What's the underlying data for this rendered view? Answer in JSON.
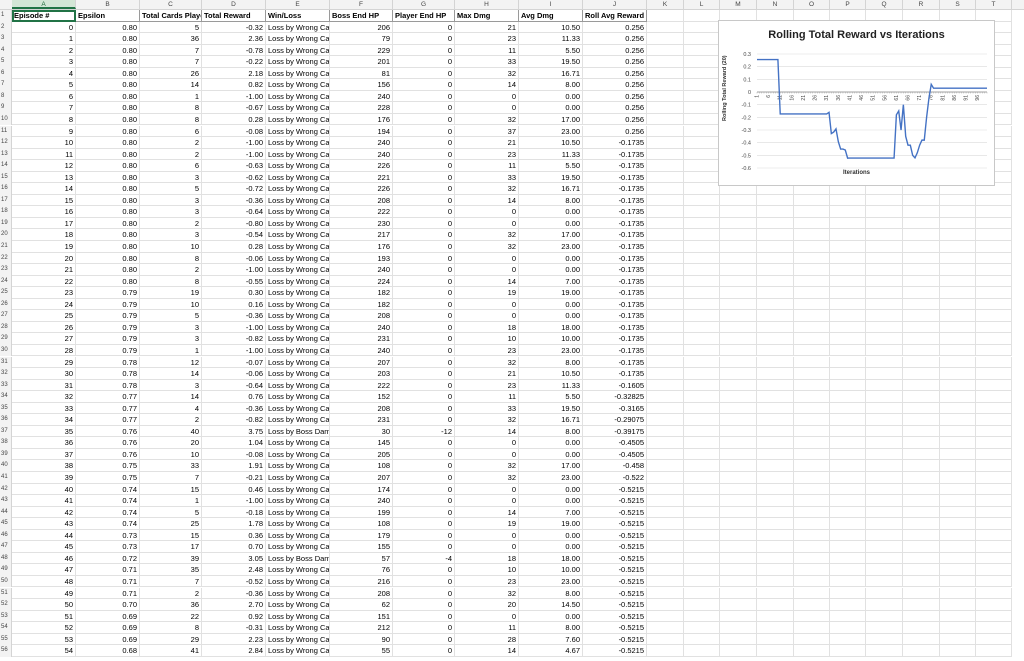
{
  "columns": [
    "A",
    "B",
    "C",
    "D",
    "E",
    "F",
    "G",
    "H",
    "I",
    "J",
    "K",
    "L",
    "M",
    "N",
    "O",
    "P",
    "Q",
    "R",
    "S",
    "T"
  ],
  "headers": [
    "Episode #",
    "Epsilon",
    "Total Cards Played",
    "Total Reward",
    "Win/Loss",
    "Boss End HP",
    "Player End HP",
    "Max Dmg",
    "Avg Dmg",
    "Roll Avg Reward"
  ],
  "rows": [
    [
      "0",
      "0.80",
      "5",
      "-0.32",
      "Loss by Wrong Card",
      "206",
      "0",
      "21",
      "10.50",
      "0.256"
    ],
    [
      "1",
      "0.80",
      "36",
      "2.36",
      "Loss by Wrong Card",
      "79",
      "0",
      "23",
      "11.33",
      "0.256"
    ],
    [
      "2",
      "0.80",
      "7",
      "-0.78",
      "Loss by Wrong Card",
      "229",
      "0",
      "11",
      "5.50",
      "0.256"
    ],
    [
      "3",
      "0.80",
      "7",
      "-0.22",
      "Loss by Wrong Card",
      "201",
      "0",
      "33",
      "19.50",
      "0.256"
    ],
    [
      "4",
      "0.80",
      "26",
      "2.18",
      "Loss by Wrong Card",
      "81",
      "0",
      "32",
      "16.71",
      "0.256"
    ],
    [
      "5",
      "0.80",
      "14",
      "0.82",
      "Loss by Wrong Card",
      "156",
      "0",
      "14",
      "8.00",
      "0.256"
    ],
    [
      "6",
      "0.80",
      "1",
      "-1.00",
      "Loss by Wrong Card",
      "240",
      "0",
      "0",
      "0.00",
      "0.256"
    ],
    [
      "7",
      "0.80",
      "8",
      "-0.67",
      "Loss by Wrong Card",
      "228",
      "0",
      "0",
      "0.00",
      "0.256"
    ],
    [
      "8",
      "0.80",
      "8",
      "0.28",
      "Loss by Wrong Card",
      "176",
      "0",
      "32",
      "17.00",
      "0.256"
    ],
    [
      "9",
      "0.80",
      "6",
      "-0.08",
      "Loss by Wrong Card",
      "194",
      "0",
      "37",
      "23.00",
      "0.256"
    ],
    [
      "10",
      "0.80",
      "2",
      "-1.00",
      "Loss by Wrong Card",
      "240",
      "0",
      "21",
      "10.50",
      "-0.1735"
    ],
    [
      "11",
      "0.80",
      "2",
      "-1.00",
      "Loss by Wrong Card",
      "240",
      "0",
      "23",
      "11.33",
      "-0.1735"
    ],
    [
      "12",
      "0.80",
      "6",
      "-0.63",
      "Loss by Wrong Card",
      "226",
      "0",
      "11",
      "5.50",
      "-0.1735"
    ],
    [
      "13",
      "0.80",
      "3",
      "-0.62",
      "Loss by Wrong Card",
      "221",
      "0",
      "33",
      "19.50",
      "-0.1735"
    ],
    [
      "14",
      "0.80",
      "5",
      "-0.72",
      "Loss by Wrong Card",
      "226",
      "0",
      "32",
      "16.71",
      "-0.1735"
    ],
    [
      "15",
      "0.80",
      "3",
      "-0.36",
      "Loss by Wrong Card",
      "208",
      "0",
      "14",
      "8.00",
      "-0.1735"
    ],
    [
      "16",
      "0.80",
      "3",
      "-0.64",
      "Loss by Wrong Card",
      "222",
      "0",
      "0",
      "0.00",
      "-0.1735"
    ],
    [
      "17",
      "0.80",
      "2",
      "-0.80",
      "Loss by Wrong Card",
      "230",
      "0",
      "0",
      "0.00",
      "-0.1735"
    ],
    [
      "18",
      "0.80",
      "3",
      "-0.54",
      "Loss by Wrong Card",
      "217",
      "0",
      "32",
      "17.00",
      "-0.1735"
    ],
    [
      "19",
      "0.80",
      "10",
      "0.28",
      "Loss by Wrong Card",
      "176",
      "0",
      "32",
      "23.00",
      "-0.1735"
    ],
    [
      "20",
      "0.80",
      "8",
      "-0.06",
      "Loss by Wrong Card",
      "193",
      "0",
      "0",
      "0.00",
      "-0.1735"
    ],
    [
      "21",
      "0.80",
      "2",
      "-1.00",
      "Loss by Wrong Card",
      "240",
      "0",
      "0",
      "0.00",
      "-0.1735"
    ],
    [
      "22",
      "0.80",
      "8",
      "-0.55",
      "Loss by Wrong Card",
      "224",
      "0",
      "14",
      "7.00",
      "-0.1735"
    ],
    [
      "23",
      "0.79",
      "19",
      "0.30",
      "Loss by Wrong Card",
      "182",
      "0",
      "19",
      "19.00",
      "-0.1735"
    ],
    [
      "24",
      "0.79",
      "10",
      "0.16",
      "Loss by Wrong Card",
      "182",
      "0",
      "0",
      "0.00",
      "-0.1735"
    ],
    [
      "25",
      "0.79",
      "5",
      "-0.36",
      "Loss by Wrong Card",
      "208",
      "0",
      "0",
      "0.00",
      "-0.1735"
    ],
    [
      "26",
      "0.79",
      "3",
      "-1.00",
      "Loss by Wrong Card",
      "240",
      "0",
      "18",
      "18.00",
      "-0.1735"
    ],
    [
      "27",
      "0.79",
      "3",
      "-0.82",
      "Loss by Wrong Card",
      "231",
      "0",
      "10",
      "10.00",
      "-0.1735"
    ],
    [
      "28",
      "0.79",
      "1",
      "-1.00",
      "Loss by Wrong Card",
      "240",
      "0",
      "23",
      "23.00",
      "-0.1735"
    ],
    [
      "29",
      "0.78",
      "12",
      "-0.07",
      "Loss by Wrong Card",
      "207",
      "0",
      "32",
      "8.00",
      "-0.1735"
    ],
    [
      "30",
      "0.78",
      "14",
      "-0.06",
      "Loss by Wrong Card",
      "203",
      "0",
      "21",
      "10.50",
      "-0.1735"
    ],
    [
      "31",
      "0.78",
      "3",
      "-0.64",
      "Loss by Wrong Card",
      "222",
      "0",
      "23",
      "11.33",
      "-0.1605"
    ],
    [
      "32",
      "0.77",
      "14",
      "0.76",
      "Loss by Wrong Card",
      "152",
      "0",
      "11",
      "5.50",
      "-0.32825"
    ],
    [
      "33",
      "0.77",
      "4",
      "-0.36",
      "Loss by Wrong Card",
      "208",
      "0",
      "33",
      "19.50",
      "-0.3165"
    ],
    [
      "34",
      "0.77",
      "2",
      "-0.82",
      "Loss by Wrong Card",
      "231",
      "0",
      "32",
      "16.71",
      "-0.29075"
    ],
    [
      "35",
      "0.76",
      "40",
      "3.75",
      "Loss by Boss Damage",
      "30",
      "-12",
      "14",
      "8.00",
      "-0.39175"
    ],
    [
      "36",
      "0.76",
      "20",
      "1.04",
      "Loss by Wrong Card",
      "145",
      "0",
      "0",
      "0.00",
      "-0.4505"
    ],
    [
      "37",
      "0.76",
      "10",
      "-0.08",
      "Loss by Wrong Card",
      "205",
      "0",
      "0",
      "0.00",
      "-0.4505"
    ],
    [
      "38",
      "0.75",
      "33",
      "1.91",
      "Loss by Wrong Card",
      "108",
      "0",
      "32",
      "17.00",
      "-0.458"
    ],
    [
      "39",
      "0.75",
      "7",
      "-0.21",
      "Loss by Wrong Card",
      "207",
      "0",
      "32",
      "23.00",
      "-0.522"
    ],
    [
      "40",
      "0.74",
      "15",
      "0.46",
      "Loss by Wrong Card",
      "174",
      "0",
      "0",
      "0.00",
      "-0.5215"
    ],
    [
      "41",
      "0.74",
      "1",
      "-1.00",
      "Loss by Wrong Card",
      "240",
      "0",
      "0",
      "0.00",
      "-0.5215"
    ],
    [
      "42",
      "0.74",
      "5",
      "-0.18",
      "Loss by Wrong Card",
      "199",
      "0",
      "14",
      "7.00",
      "-0.5215"
    ],
    [
      "43",
      "0.74",
      "25",
      "1.78",
      "Loss by Wrong Card",
      "108",
      "0",
      "19",
      "19.00",
      "-0.5215"
    ],
    [
      "44",
      "0.73",
      "15",
      "0.36",
      "Loss by Wrong Card",
      "179",
      "0",
      "0",
      "0.00",
      "-0.5215"
    ],
    [
      "45",
      "0.73",
      "17",
      "0.70",
      "Loss by Wrong Card",
      "155",
      "0",
      "0",
      "0.00",
      "-0.5215"
    ],
    [
      "46",
      "0.72",
      "39",
      "3.05",
      "Loss by Boss Damage",
      "57",
      "-4",
      "18",
      "18.00",
      "-0.5215"
    ],
    [
      "47",
      "0.71",
      "35",
      "2.48",
      "Loss by Wrong Card",
      "76",
      "0",
      "10",
      "10.00",
      "-0.5215"
    ],
    [
      "48",
      "0.71",
      "7",
      "-0.52",
      "Loss by Wrong Card",
      "216",
      "0",
      "23",
      "23.00",
      "-0.5215"
    ],
    [
      "49",
      "0.71",
      "2",
      "-0.36",
      "Loss by Wrong Card",
      "208",
      "0",
      "32",
      "8.00",
      "-0.5215"
    ],
    [
      "50",
      "0.70",
      "36",
      "2.70",
      "Loss by Wrong Card",
      "62",
      "0",
      "20",
      "14.50",
      "-0.5215"
    ],
    [
      "51",
      "0.69",
      "22",
      "0.92",
      "Loss by Wrong Card",
      "151",
      "0",
      "0",
      "0.00",
      "-0.5215"
    ],
    [
      "52",
      "0.69",
      "8",
      "-0.31",
      "Loss by Wrong Card",
      "212",
      "0",
      "11",
      "8.00",
      "-0.5215"
    ],
    [
      "53",
      "0.69",
      "29",
      "2.23",
      "Loss by Wrong Card",
      "90",
      "0",
      "28",
      "7.60",
      "-0.5215"
    ],
    [
      "54",
      "0.68",
      "41",
      "2.84",
      "Loss by Wrong Card",
      "55",
      "0",
      "14",
      "4.67",
      "-0.5215"
    ]
  ],
  "chart_data": {
    "type": "line",
    "title": "Rolling Total Reward vs Iterations",
    "xlabel": "Iterations",
    "ylabel": "Rolling Total Reward (20)",
    "ylim": [
      -0.6,
      0.3
    ],
    "yticks": [
      "0.3",
      "0.2",
      "0.1",
      "0",
      "-0.1",
      "-0.2",
      "-0.3",
      "-0.4",
      "-0.5",
      "-0.6"
    ],
    "xticks": [
      "1",
      "6",
      "11",
      "16",
      "21",
      "26",
      "31",
      "36",
      "41",
      "46",
      "51",
      "56",
      "61",
      "66",
      "71",
      "76",
      "81",
      "86",
      "91",
      "96"
    ],
    "series": [
      {
        "values": [
          0.256,
          0.256,
          0.256,
          0.256,
          0.256,
          0.256,
          0.256,
          0.256,
          0.256,
          0.256,
          -0.1735,
          -0.1735,
          -0.1735,
          -0.1735,
          -0.1735,
          -0.1735,
          -0.1735,
          -0.1735,
          -0.1735,
          -0.1735,
          -0.1735,
          -0.1735,
          -0.1735,
          -0.1735,
          -0.1735,
          -0.1735,
          -0.1735,
          -0.1735,
          -0.1735,
          -0.1735,
          -0.1735,
          -0.1605,
          -0.32825,
          -0.3165,
          -0.29075,
          -0.39175,
          -0.4505,
          -0.4505,
          -0.458,
          -0.522,
          -0.5215,
          -0.5215,
          -0.5215,
          -0.5215,
          -0.5215,
          -0.5215,
          -0.5215,
          -0.5215,
          -0.5215,
          -0.5215,
          -0.5215,
          -0.5215,
          -0.5215,
          -0.5215,
          -0.5215,
          -0.5215,
          -0.5215,
          -0.5215,
          -0.5215,
          -0.5215,
          -0.18,
          -0.15,
          -0.3,
          -0.1,
          -0.35,
          -0.42,
          -0.42,
          -0.5,
          -0.52,
          -0.48,
          -0.42,
          -0.38,
          -0.38,
          -0.2,
          -0.05,
          0.06,
          0.03,
          0.03,
          0.03,
          0.03,
          0.03,
          0.03,
          0.03,
          0.03,
          0.03,
          0.03,
          0.03,
          0.03,
          0.03,
          0.03,
          0.03,
          0.03,
          0.03,
          0.03,
          0.03,
          0.03,
          0.03,
          0.03,
          0.03,
          0.03
        ],
        "color": "#4472c4"
      }
    ]
  }
}
